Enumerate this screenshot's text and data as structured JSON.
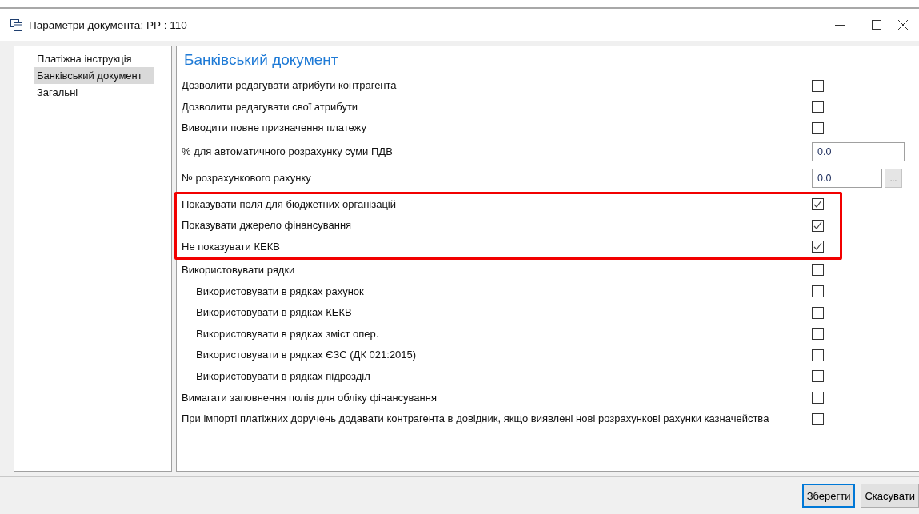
{
  "window": {
    "title": "Параметри документа: РР : 110"
  },
  "sidebar": {
    "items": [
      {
        "label": "Платіжна інструкція",
        "selected": false
      },
      {
        "label": "Банківський документ",
        "selected": true
      },
      {
        "label": "Загальні",
        "selected": false
      }
    ]
  },
  "section_title": "Банківський документ",
  "settings": [
    {
      "kind": "checkbox",
      "label": "Дозволити редагувати атрибути контрагента",
      "checked": false,
      "indented": false
    },
    {
      "kind": "checkbox",
      "label": "Дозволити редагувати свої атрибути",
      "checked": false,
      "indented": false
    },
    {
      "kind": "checkbox",
      "label": "Виводити повне призначення платежу",
      "checked": false,
      "indented": false
    },
    {
      "kind": "field",
      "label": "% для автоматичного розрахунку суми ПДВ",
      "value": "0.0",
      "indented": false
    },
    {
      "kind": "picker",
      "label": "№ розрахункового рахунку",
      "value": "0.0",
      "button": "...",
      "indented": false
    },
    {
      "kind": "highlight_group",
      "children": [
        {
          "kind": "checkbox",
          "label": "Показувати поля для бюджетних організацій",
          "checked": true,
          "indented": false
        },
        {
          "kind": "checkbox",
          "label": "Показувати джерело фінансування",
          "checked": true,
          "indented": false
        },
        {
          "kind": "checkbox",
          "label": "Не показувати КЕКВ",
          "checked": true,
          "indented": false
        }
      ]
    },
    {
      "kind": "checkbox",
      "label": "Використовувати рядки",
      "checked": false,
      "indented": false
    },
    {
      "kind": "checkbox",
      "label": "Використовувати в рядках рахунок",
      "checked": false,
      "indented": true
    },
    {
      "kind": "checkbox",
      "label": "Використовувати в рядках КЕКВ",
      "checked": false,
      "indented": true
    },
    {
      "kind": "checkbox",
      "label": "Використовувати в рядках зміст опер.",
      "checked": false,
      "indented": true
    },
    {
      "kind": "checkbox",
      "label": "Використовувати в рядках ЄЗС (ДК 021:2015)",
      "checked": false,
      "indented": true
    },
    {
      "kind": "checkbox",
      "label": "Використовувати в рядках підрозділ",
      "checked": false,
      "indented": true
    },
    {
      "kind": "checkbox",
      "label": "Вимагати заповнення полів для обліку фінансування",
      "checked": false,
      "indented": false
    },
    {
      "kind": "checkbox",
      "label": "При імпорті платіжних доручень додавати контрагента в довідник, якщо виявлені нові розрахункові рахунки казначейства",
      "checked": false,
      "indented": false
    }
  ],
  "buttons": [
    {
      "label": "Зберегти",
      "default": true
    },
    {
      "label": "Скасувати",
      "default": false
    }
  ]
}
